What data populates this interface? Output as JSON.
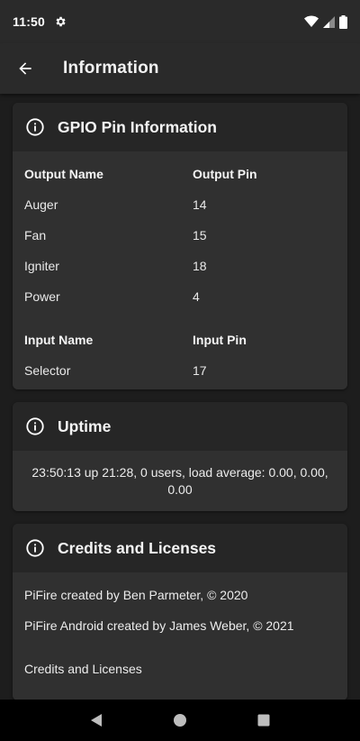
{
  "status_bar": {
    "time": "11:50",
    "icons": [
      "gear-icon",
      "wifi-icon",
      "signal-icon",
      "battery-icon"
    ]
  },
  "app_bar": {
    "title": "Information",
    "back_icon": "arrow-back-icon"
  },
  "gpio_card": {
    "title": "GPIO Pin Information",
    "output_header": [
      "Output Name",
      "Output Pin"
    ],
    "outputs": [
      {
        "name": "Auger",
        "pin": "14"
      },
      {
        "name": "Fan",
        "pin": "15"
      },
      {
        "name": "Igniter",
        "pin": "18"
      },
      {
        "name": "Power",
        "pin": "4"
      }
    ],
    "input_header": [
      "Input Name",
      "Input Pin"
    ],
    "inputs": [
      {
        "name": "Selector",
        "pin": "17"
      }
    ]
  },
  "uptime_card": {
    "title": "Uptime",
    "text": "23:50:13 up 21:28,  0 users,  load average: 0.00, 0.00, 0.00"
  },
  "credits_card": {
    "title": "Credits and Licenses",
    "lines": [
      "PiFire created by Ben Parmeter, © 2020",
      "PiFire Android created by James Weber, © 2021"
    ],
    "link": "Credits and Licenses"
  },
  "nav_bar": {
    "buttons": [
      "back-triangle-icon",
      "home-circle-icon",
      "recents-square-icon"
    ]
  },
  "colors": {
    "background": "#1d1d1d",
    "bar": "#2a2a2a",
    "card": "#303030",
    "card_header": "#262626",
    "text": "#e9e9e9"
  }
}
